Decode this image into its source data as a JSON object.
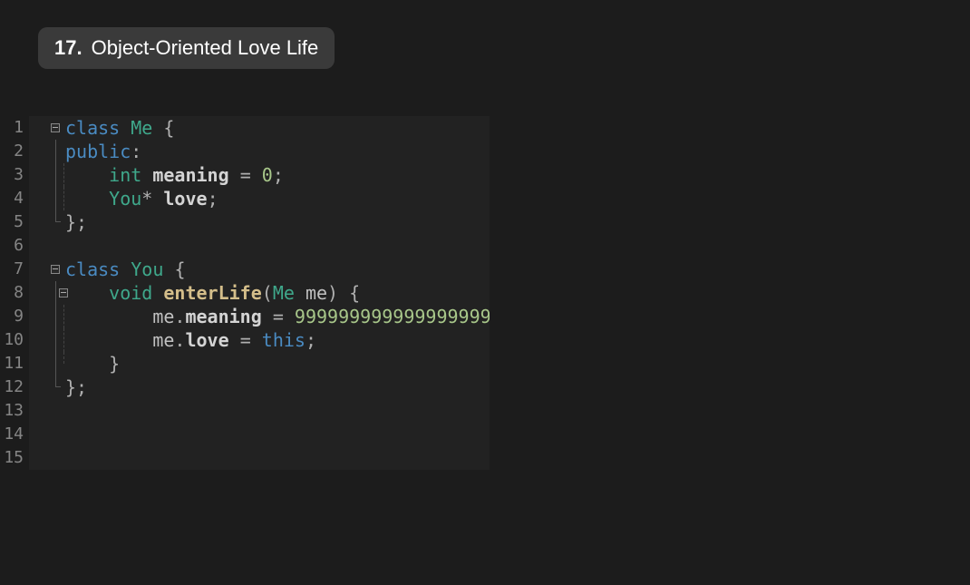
{
  "title": {
    "number": "17.",
    "text": "Object-Oriented Love Life"
  },
  "editor": {
    "line_numbers": [
      "1",
      "2",
      "3",
      "4",
      "5",
      "6",
      "7",
      "8",
      "9",
      "10",
      "11",
      "12",
      "13",
      "14",
      "15"
    ],
    "tokens": {
      "l1": {
        "kw": "class",
        "sp1": " ",
        "type": "Me",
        "sp2": " ",
        "brace": "{"
      },
      "l2": {
        "kw": "public",
        "colon": ":"
      },
      "l3": {
        "indent": "    ",
        "type": "int",
        "sp": " ",
        "id": "meaning",
        "sp2": " ",
        "eq": "=",
        "sp3": " ",
        "num": "0",
        "semi": ";"
      },
      "l4": {
        "indent": "    ",
        "type": "You",
        "star": "*",
        "sp": " ",
        "id": "love",
        "semi": ";"
      },
      "l5": {
        "brace": "}",
        "semi": ";"
      },
      "l6": "",
      "l7": {
        "kw": "class",
        "sp1": " ",
        "type": "You",
        "sp2": " ",
        "brace": "{"
      },
      "l8": {
        "indent": "    ",
        "type": "void",
        "sp": " ",
        "fn": "enterLife",
        "paren1": "(",
        "ptype": "Me",
        "sp2": " ",
        "pname": "me",
        "paren2": ")",
        "sp3": " ",
        "brace": "{"
      },
      "l9": {
        "indent": "        ",
        "obj": "me",
        "dot": ".",
        "prop": "meaning",
        "sp": " ",
        "eq": "=",
        "sp2": " ",
        "num": "999999999999999999"
      },
      "l10": {
        "indent": "        ",
        "obj": "me",
        "dot": ".",
        "prop": "love",
        "sp": " ",
        "eq": "=",
        "sp2": " ",
        "kw": "this",
        "semi": ";"
      },
      "l11": {
        "indent": "    ",
        "brace": "}"
      },
      "l12": {
        "brace": "}",
        "semi": ";"
      },
      "l13": "",
      "l14": "",
      "l15": ""
    }
  }
}
